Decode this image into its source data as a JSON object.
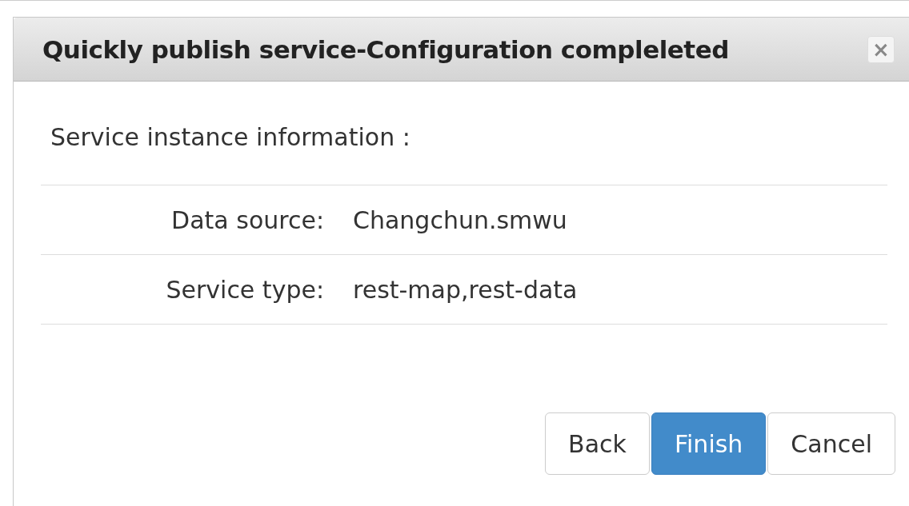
{
  "dialog": {
    "title": "Quickly publish service-Configuration compleleted",
    "close": "×"
  },
  "section_heading": "Service instance information :",
  "fields": [
    {
      "label": "Data source:",
      "value": "Changchun.smwu"
    },
    {
      "label": "Service type:",
      "value": "rest-map,rest-data"
    }
  ],
  "buttons": [
    {
      "label": "Back",
      "kind": "default"
    },
    {
      "label": "Finish",
      "kind": "primary"
    },
    {
      "label": "Cancel",
      "kind": "default"
    }
  ]
}
